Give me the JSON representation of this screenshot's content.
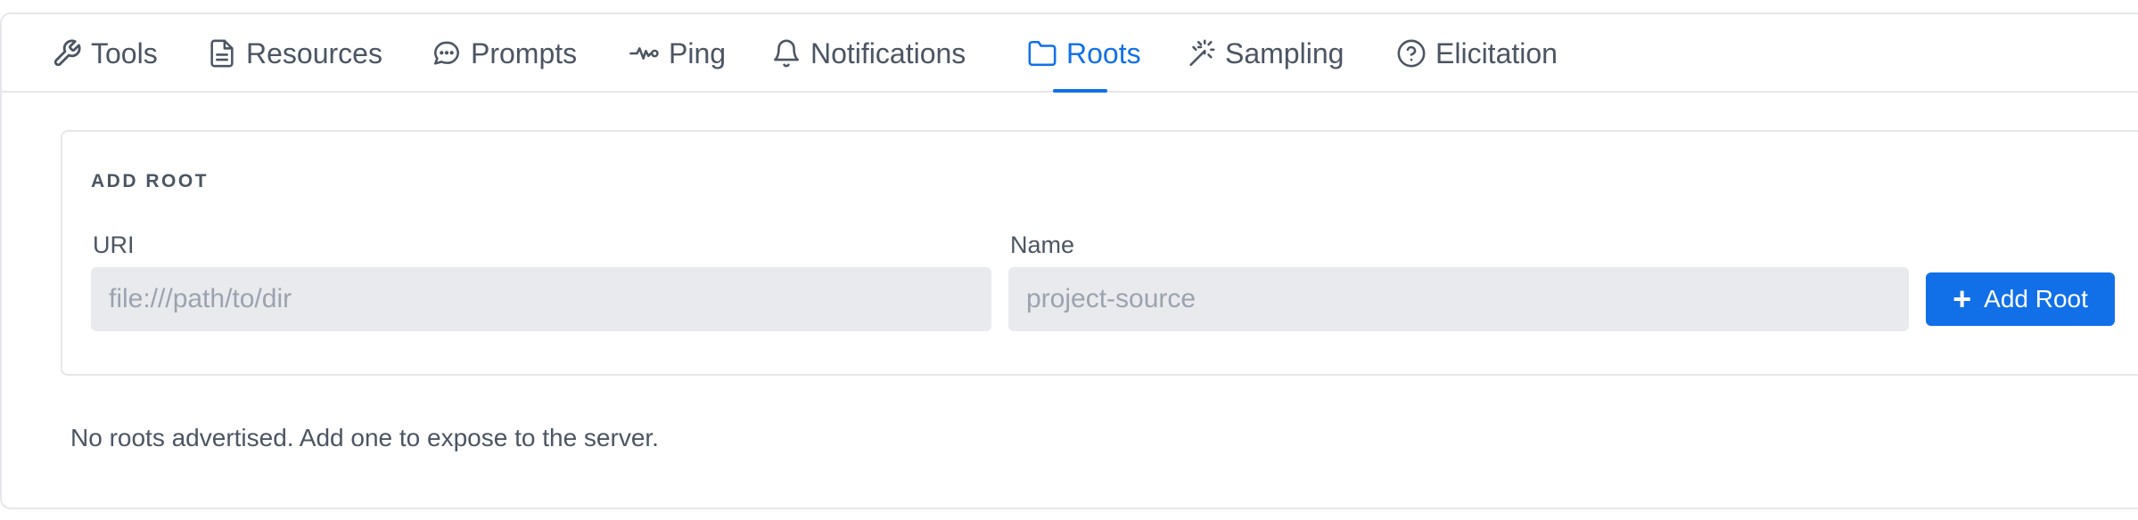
{
  "tabs": [
    {
      "label": "Tools",
      "icon": "wrench-icon"
    },
    {
      "label": "Resources",
      "icon": "document-icon"
    },
    {
      "label": "Prompts",
      "icon": "chat-bubble-icon"
    },
    {
      "label": "Ping",
      "icon": "pulse-icon"
    },
    {
      "label": "Notifications",
      "icon": "bell-icon"
    },
    {
      "label": "Roots",
      "icon": "folder-icon",
      "active": true
    },
    {
      "label": "Sampling",
      "icon": "magic-wand-icon"
    },
    {
      "label": "Elicitation",
      "icon": "question-circle-icon"
    }
  ],
  "add_root": {
    "title": "ADD ROOT",
    "uri_label": "URI",
    "uri_placeholder": "file:///path/to/dir",
    "name_label": "Name",
    "name_placeholder": "project-source",
    "button_label": "Add Root"
  },
  "empty_state": "No roots advertised. Add one to expose to the server.",
  "colors": {
    "accent": "#1170e8",
    "text": "#4b5563",
    "input_bg": "#e8eaed",
    "border": "#e5e7eb"
  }
}
